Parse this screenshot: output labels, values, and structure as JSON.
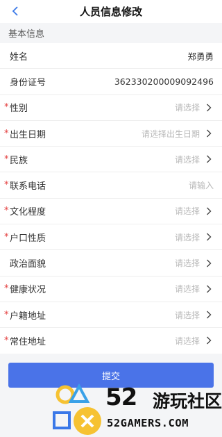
{
  "header": {
    "title": "人员信息修改"
  },
  "section": {
    "title": "基本信息"
  },
  "fields": [
    {
      "label": "姓名",
      "required": false,
      "value": "郑勇勇",
      "placeholder": "",
      "arrow": false
    },
    {
      "label": "身份证号",
      "required": false,
      "value": "362330200009092496",
      "placeholder": "",
      "arrow": false
    },
    {
      "label": "性别",
      "required": true,
      "value": "",
      "placeholder": "请选择",
      "arrow": true
    },
    {
      "label": "出生日期",
      "required": true,
      "value": "",
      "placeholder": "请选择出生日期",
      "arrow": true
    },
    {
      "label": "民族",
      "required": true,
      "value": "",
      "placeholder": "请选择",
      "arrow": true
    },
    {
      "label": "联系电话",
      "required": true,
      "value": "",
      "placeholder": "请输入",
      "arrow": false
    },
    {
      "label": "文化程度",
      "required": true,
      "value": "",
      "placeholder": "请选择",
      "arrow": true
    },
    {
      "label": "户口性质",
      "required": true,
      "value": "",
      "placeholder": "请选择",
      "arrow": true
    },
    {
      "label": "政治面貌",
      "required": false,
      "value": "",
      "placeholder": "请选择",
      "arrow": true
    },
    {
      "label": "健康状况",
      "required": true,
      "value": "",
      "placeholder": "请选择",
      "arrow": true
    },
    {
      "label": "户籍地址",
      "required": true,
      "value": "",
      "placeholder": "请选择",
      "arrow": true
    },
    {
      "label": "常住地址",
      "required": true,
      "value": "",
      "placeholder": "请选择",
      "arrow": true
    }
  ],
  "required_mark": "*",
  "submit": {
    "label": "提交"
  },
  "watermark": {
    "num": "52",
    "cn": "游玩社区",
    "en": "52GAMERS.COM"
  },
  "colors": {
    "accent": "#4a73e8",
    "required": "#e23b3b",
    "placeholder": "#b8b8b8"
  },
  "icons": {
    "back": "chevron-left-icon",
    "arrow": "chevron-right-icon"
  }
}
